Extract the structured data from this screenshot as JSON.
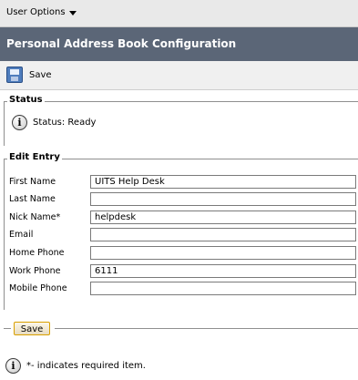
{
  "topbar": {
    "user_options_label": "User Options"
  },
  "title": "Personal Address Book Configuration",
  "toolbar": {
    "save_label": "Save"
  },
  "status": {
    "legend": "Status",
    "text": "Status: Ready",
    "icon": "info-icon"
  },
  "entry": {
    "legend": "Edit Entry",
    "fields": [
      {
        "label": "First Name",
        "value": "UITS Help Desk"
      },
      {
        "label": "Last Name",
        "value": ""
      },
      {
        "label": "Nick Name*",
        "value": "helpdesk"
      },
      {
        "label": "Email",
        "value": ""
      },
      {
        "label": "Home Phone",
        "value": ""
      },
      {
        "label": "Work Phone",
        "value": "6111"
      },
      {
        "label": "Mobile Phone",
        "value": ""
      }
    ]
  },
  "bottom": {
    "save_label": "Save"
  },
  "note": {
    "text": "*- indicates required item.",
    "icon": "info-icon"
  },
  "colors": {
    "title_bar": "#5b6677",
    "save_button_border": "#d9a000"
  }
}
